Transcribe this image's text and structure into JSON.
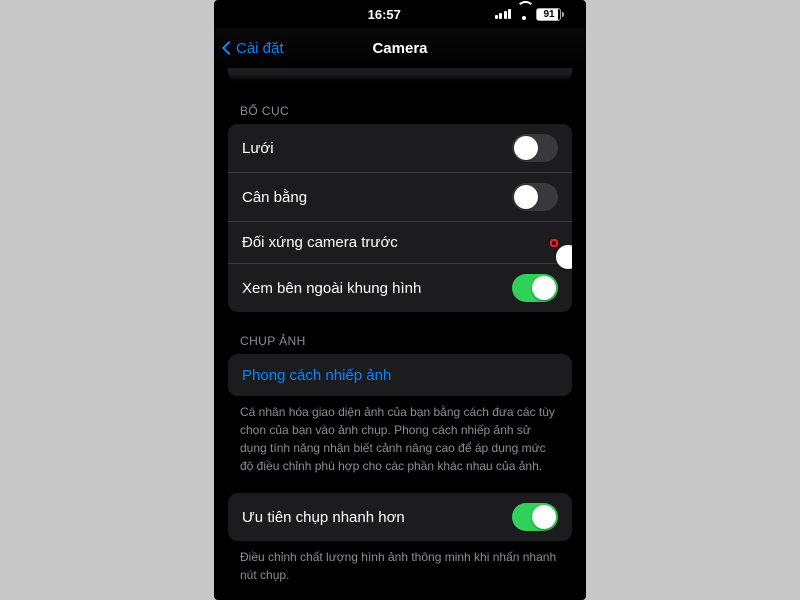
{
  "status": {
    "time": "16:57",
    "battery_pct": "91"
  },
  "nav": {
    "back_label": "Cài đặt",
    "title": "Camera"
  },
  "sections": {
    "layout": {
      "header": "BỐ CỤC",
      "rows": {
        "grid": {
          "label": "Lưới",
          "on": false
        },
        "level": {
          "label": "Cân bằng",
          "on": false
        },
        "mirror_front": {
          "label": "Đối xứng camera trước",
          "on": false,
          "highlighted": true
        },
        "view_outside_frame": {
          "label": "Xem bên ngoài khung hình",
          "on": true
        }
      }
    },
    "capture": {
      "header": "CHỤP ẢNH",
      "rows": {
        "photo_styles": {
          "label": "Phong cách nhiếp ảnh"
        }
      },
      "footer": "Cá nhân hóa giao diện ảnh của bạn bằng cách đưa các tùy chọn của bạn vào ảnh chụp. Phong cách nhiếp ảnh sử dụng tính năng nhận biết cảnh nâng cao để áp dụng mức độ điều chỉnh phù hợp cho các phần khác nhau của ảnh."
    },
    "priority": {
      "rows": {
        "faster_shooting": {
          "label": "Ưu tiên chụp nhanh hơn",
          "on": true
        }
      },
      "footer": "Điều chỉnh chất lượng hình ảnh thông minh khi nhấn nhanh nút chụp."
    }
  }
}
